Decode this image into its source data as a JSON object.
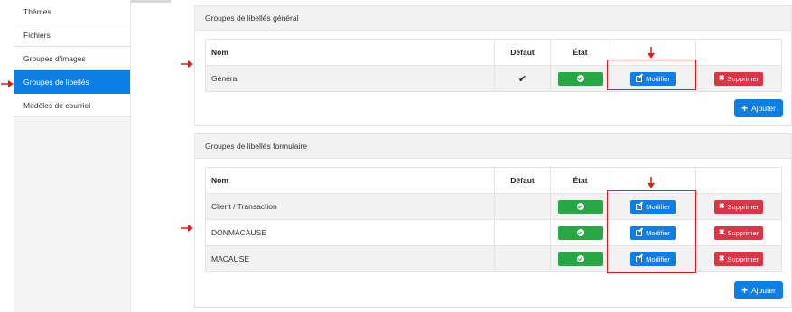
{
  "sidebar": {
    "items": [
      {
        "label": "Thèmes"
      },
      {
        "label": "Fichiers"
      },
      {
        "label": "Groupes d'images"
      },
      {
        "label": "Groupes de libellés"
      },
      {
        "label": "Modèles de courriel"
      }
    ],
    "active_index": 3
  },
  "general_panel": {
    "title": "Groupes de libellés général",
    "columns": {
      "name": "Nom",
      "default": "Défaut",
      "state": "État"
    },
    "rows": [
      {
        "name": "Général",
        "default": "✔",
        "edit": "Modifier",
        "delete": "Supprimer"
      }
    ],
    "add_label": "Ajouter"
  },
  "form_panel": {
    "title": "Groupes de libellés formulaire",
    "columns": {
      "name": "Nom",
      "default": "Défaut",
      "state": "État"
    },
    "rows": [
      {
        "name": "Client / Transaction",
        "edit": "Modifier",
        "delete": "Supprimer"
      },
      {
        "name": "DONMACAUSE",
        "edit": "Modifier",
        "delete": "Supprimer"
      },
      {
        "name": "MACAUSE",
        "edit": "Modifier",
        "delete": "Supprimer"
      }
    ],
    "add_label": "Ajouter"
  },
  "colors": {
    "primary": "#0d7ee6",
    "success": "#28a745",
    "danger": "#dc3545",
    "annotation": "#e01b1b"
  }
}
